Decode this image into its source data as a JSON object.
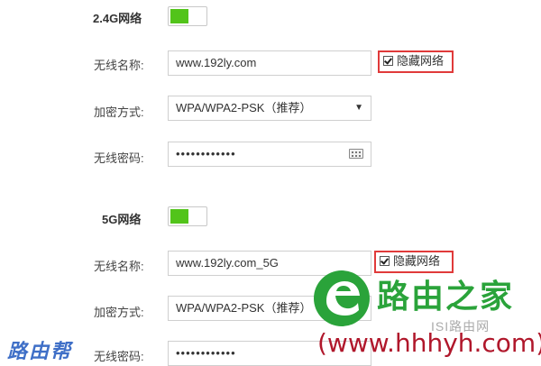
{
  "band24": {
    "title": "2.4G网络",
    "ssid_label": "无线名称:",
    "ssid_value": "www.192ly.com",
    "hide_label": "隐藏网络",
    "enc_label": "加密方式:",
    "enc_value": "WPA/WPA2-PSK（推荐）",
    "pwd_label": "无线密码:",
    "pwd_value": "••••••••••••"
  },
  "band5": {
    "title": "5G网络",
    "ssid_label": "无线名称:",
    "ssid_value": "www.192ly.com_5G",
    "hide_label": "隐藏网络",
    "enc_label": "加密方式:",
    "enc_value": "WPA/WPA2-PSK（推荐）",
    "pwd_label": "无线密码:",
    "pwd_value": "••••••••••••"
  },
  "watermark": {
    "brand_cn": "路由之家",
    "url": "(www.hhhyh.com)",
    "sub": "ISI路由网",
    "left_logo": "路由帮"
  },
  "colors": {
    "toggle_on": "#52c41a",
    "highlight_border": "#e03a3a",
    "brand_green": "#2aa33a",
    "url_red": "#b0172b"
  }
}
